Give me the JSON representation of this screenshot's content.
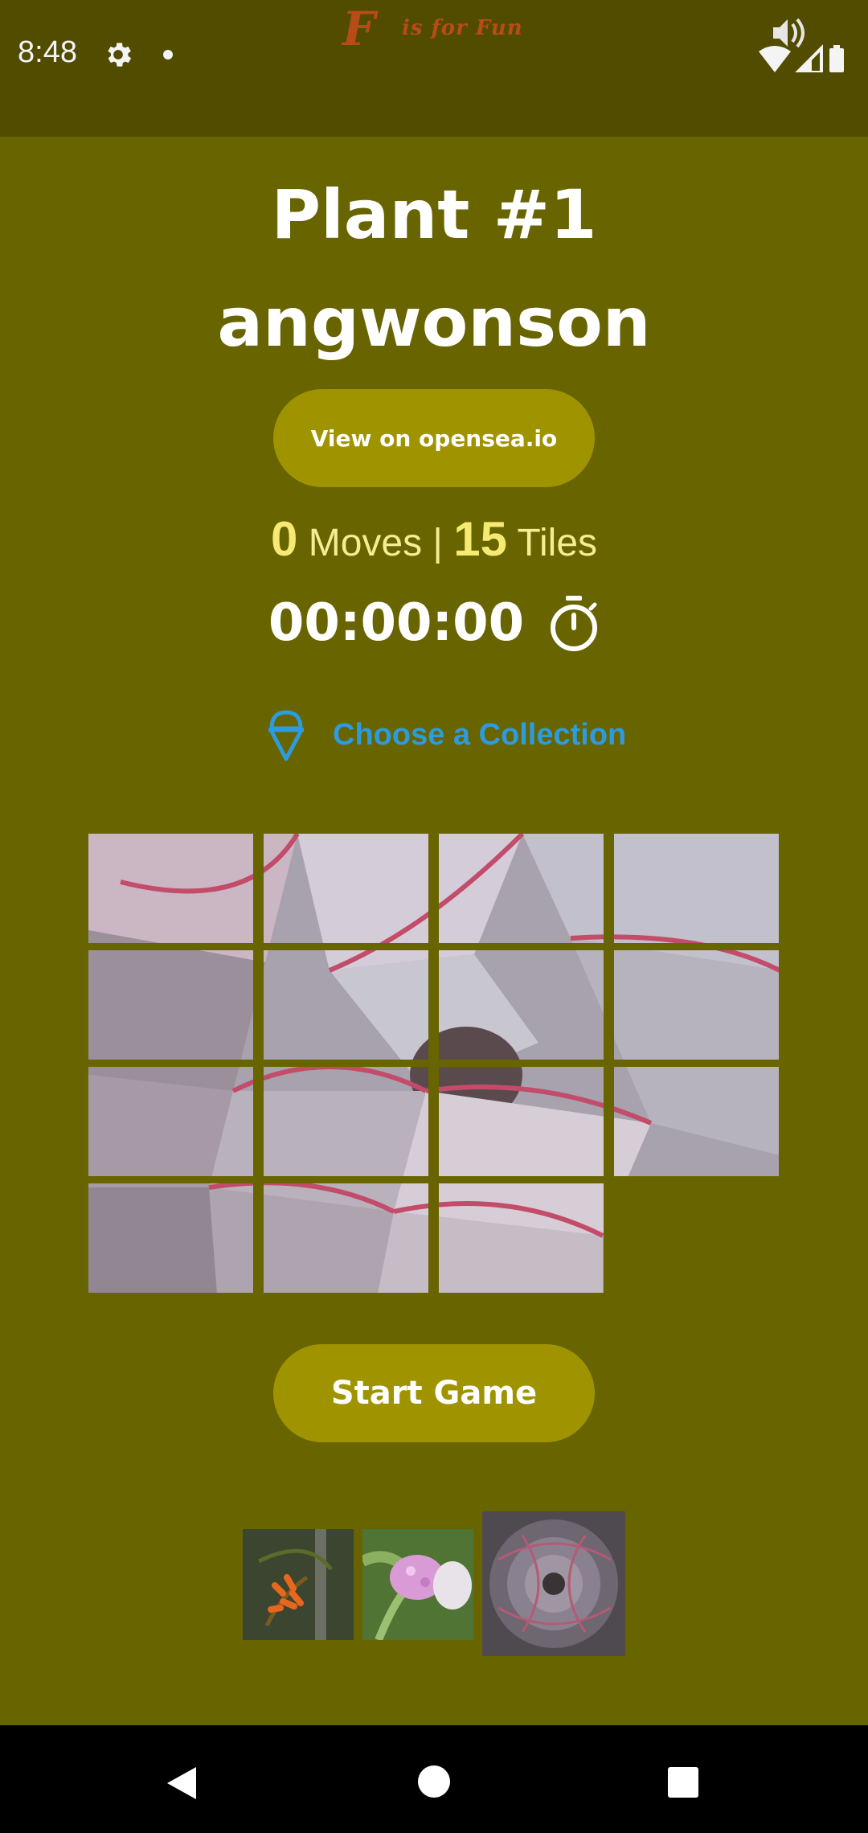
{
  "status_bar": {
    "time": "8:48",
    "icons": [
      "settings-gear-icon",
      "notification-dot-icon",
      "volume-icon",
      "wifi-icon",
      "signal-icon",
      "battery-icon"
    ]
  },
  "brand": {
    "letter": "F",
    "text": "is for Fun",
    "color": "#b94b17"
  },
  "header": {
    "title_line1": "Plant #1",
    "title_line2": "angwonson"
  },
  "view_button": {
    "label": "View on opensea.io"
  },
  "stats": {
    "moves": "0",
    "moves_label": "Moves",
    "separator": "|",
    "tiles": "15",
    "tiles_label": "Tiles"
  },
  "timer": {
    "value": "00:00:00",
    "icon": "stopwatch-icon"
  },
  "collection_link": {
    "label": "Choose a Collection",
    "icon": "ice-cream-cone-icon",
    "color": "#2c9be0"
  },
  "puzzle": {
    "rows": 4,
    "cols": 4,
    "tile_count": 15,
    "empty_slot": {
      "row": 4,
      "col": 4
    },
    "image": "succulent-plant"
  },
  "start_button": {
    "label": "Start Game"
  },
  "thumbnails": [
    {
      "name": "orange-flower",
      "selected": false
    },
    {
      "name": "pink-flower",
      "selected": false
    },
    {
      "name": "succulent",
      "selected": true
    }
  ],
  "colors": {
    "background": "#686400",
    "status_bar": "#514c00",
    "button": "#9f9400",
    "stat_numbers": "#f6ea73"
  }
}
